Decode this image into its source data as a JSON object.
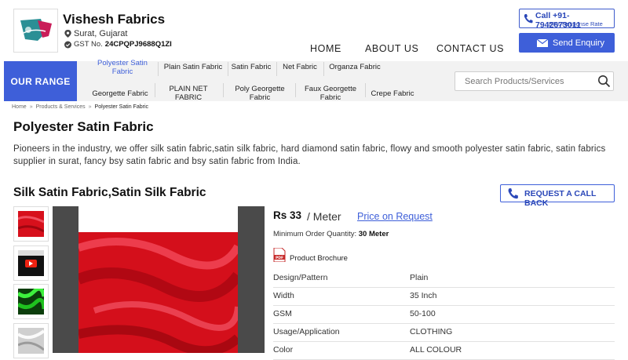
{
  "header": {
    "company_name": "Vishesh Fabrics",
    "location": "Surat, Gujarat",
    "gst_label": "GST No.",
    "gst_number": "24CPQPJ9688Q1ZI",
    "nav": [
      "HOME",
      "ABOUT US",
      "CONTACT US"
    ],
    "call_label": "Call +91-7942673011",
    "response_rate": "87% Response Rate",
    "enquiry_label": "Send Enquiry"
  },
  "range": {
    "label": "OUR RANGE",
    "categories_row1": [
      "Polyester Satin Fabric",
      "Plain Satin Fabric",
      "Satin Fabric",
      "Net Fabric",
      "Organza Fabric"
    ],
    "categories_row2": [
      "Georgette Fabric",
      "PLAIN NET FABRIC",
      "Poly Georgette Fabric",
      "Faux Georgette Fabric",
      "Crepe Fabric"
    ],
    "active_category": "Polyester Satin Fabric",
    "search_placeholder": "Search Products/Services"
  },
  "breadcrumb": [
    "Home",
    "Products & Services",
    "Polyester Satin Fabric"
  ],
  "page": {
    "title": "Polyester Satin Fabric",
    "intro": "Pioneers in the industry, we offer silk satin fabric,satin silk fabric, hard diamond satin fabric, flowy and smooth polyester satin fabric, satin fabrics supplier in surat, fancy bsy satin fabric and bsy satin fabric from India."
  },
  "product": {
    "title": "Silk Satin Fabric,Satin Silk Fabric",
    "callback_label": "REQUEST A CALL BACK",
    "price": "Rs 33",
    "unit": "/ Meter",
    "price_request": "Price on Request",
    "moq_label": "Minimum Order Quantity:",
    "moq_value": "30 Meter",
    "brochure_label": "Product Brochure",
    "specs": [
      {
        "key": "Design/Pattern",
        "value": "Plain"
      },
      {
        "key": "Width",
        "value": "35 Inch"
      },
      {
        "key": "GSM",
        "value": "50-100"
      },
      {
        "key": "Usage/Application",
        "value": "CLOTHING"
      },
      {
        "key": "Color",
        "value": "ALL COLOUR"
      }
    ]
  },
  "colors": {
    "accent": "#3e5fd9",
    "fabric_red": "#d7101c",
    "thumb_green": "#1fc21f"
  }
}
